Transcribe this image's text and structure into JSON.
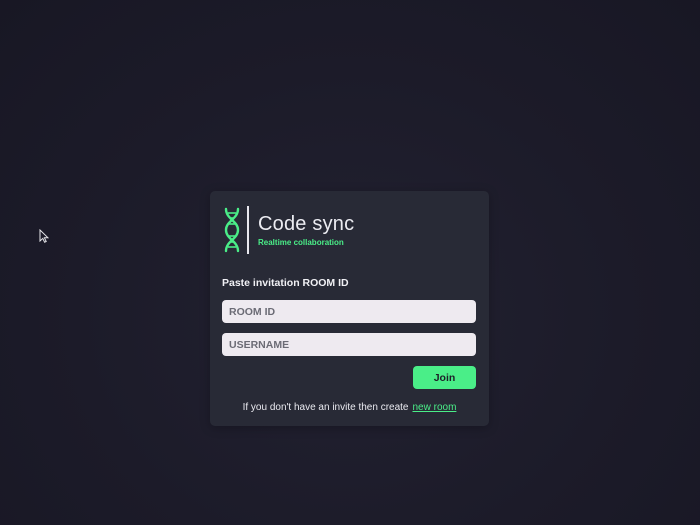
{
  "brand": {
    "title": "Code sync",
    "subtitle": "Realtime collaboration",
    "logo_icon": "dna-icon",
    "accent_color": "#4aee88"
  },
  "form": {
    "label": "Paste invitation ROOM ID",
    "room_id": {
      "value": "",
      "placeholder": "ROOM ID"
    },
    "username": {
      "value": "",
      "placeholder": "USERNAME"
    },
    "join_label": "Join"
  },
  "footer": {
    "text": "If you don't have an invite then create",
    "link_label": "new room"
  },
  "colors": {
    "background": "#1c1b29",
    "card": "#282a36",
    "input": "#eeeaf0"
  }
}
